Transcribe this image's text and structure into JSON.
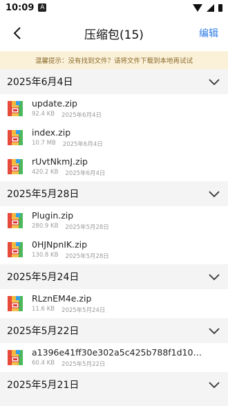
{
  "status": {
    "time": "10:09",
    "a_icon": "A"
  },
  "header": {
    "title": "压缩包(15)",
    "edit_label": "编辑"
  },
  "tip": "温馨提示：没有找到文件？请将文件下载到本地再试试",
  "groups": [
    {
      "date": "2025年6月4日",
      "files": [
        {
          "name": "update.zip",
          "size": "92.4 KB",
          "date": "2025年6月4日"
        },
        {
          "name": "index.zip",
          "size": "10.7 MB",
          "date": "2025年6月4日"
        },
        {
          "name": "rUvtNkmJ.zip",
          "size": "420.2 KB",
          "date": "2025年6月4日"
        }
      ]
    },
    {
      "date": "2025年5月28日",
      "files": [
        {
          "name": "Plugin.zip",
          "size": "280.9 KB",
          "date": "2025年5月28日"
        },
        {
          "name": "0HJNpnIK.zip",
          "size": "130.8 KB",
          "date": "2025年5月28日"
        }
      ]
    },
    {
      "date": "2025年5月24日",
      "files": [
        {
          "name": "RLznEM4e.zip",
          "size": "11.6 KB",
          "date": "2025年5月24日"
        }
      ]
    },
    {
      "date": "2025年5月22日",
      "files": [
        {
          "name": "a1396e41ff30e302a5c425b788f1d10c...",
          "size": "60.4 KB",
          "date": "2025年5月22日"
        }
      ]
    },
    {
      "date": "2025年5月21日",
      "files": []
    }
  ],
  "colors": {
    "accent": "#2b7be4",
    "tip_bg": "#fbf1d9",
    "tip_text": "#8a6a2b"
  }
}
